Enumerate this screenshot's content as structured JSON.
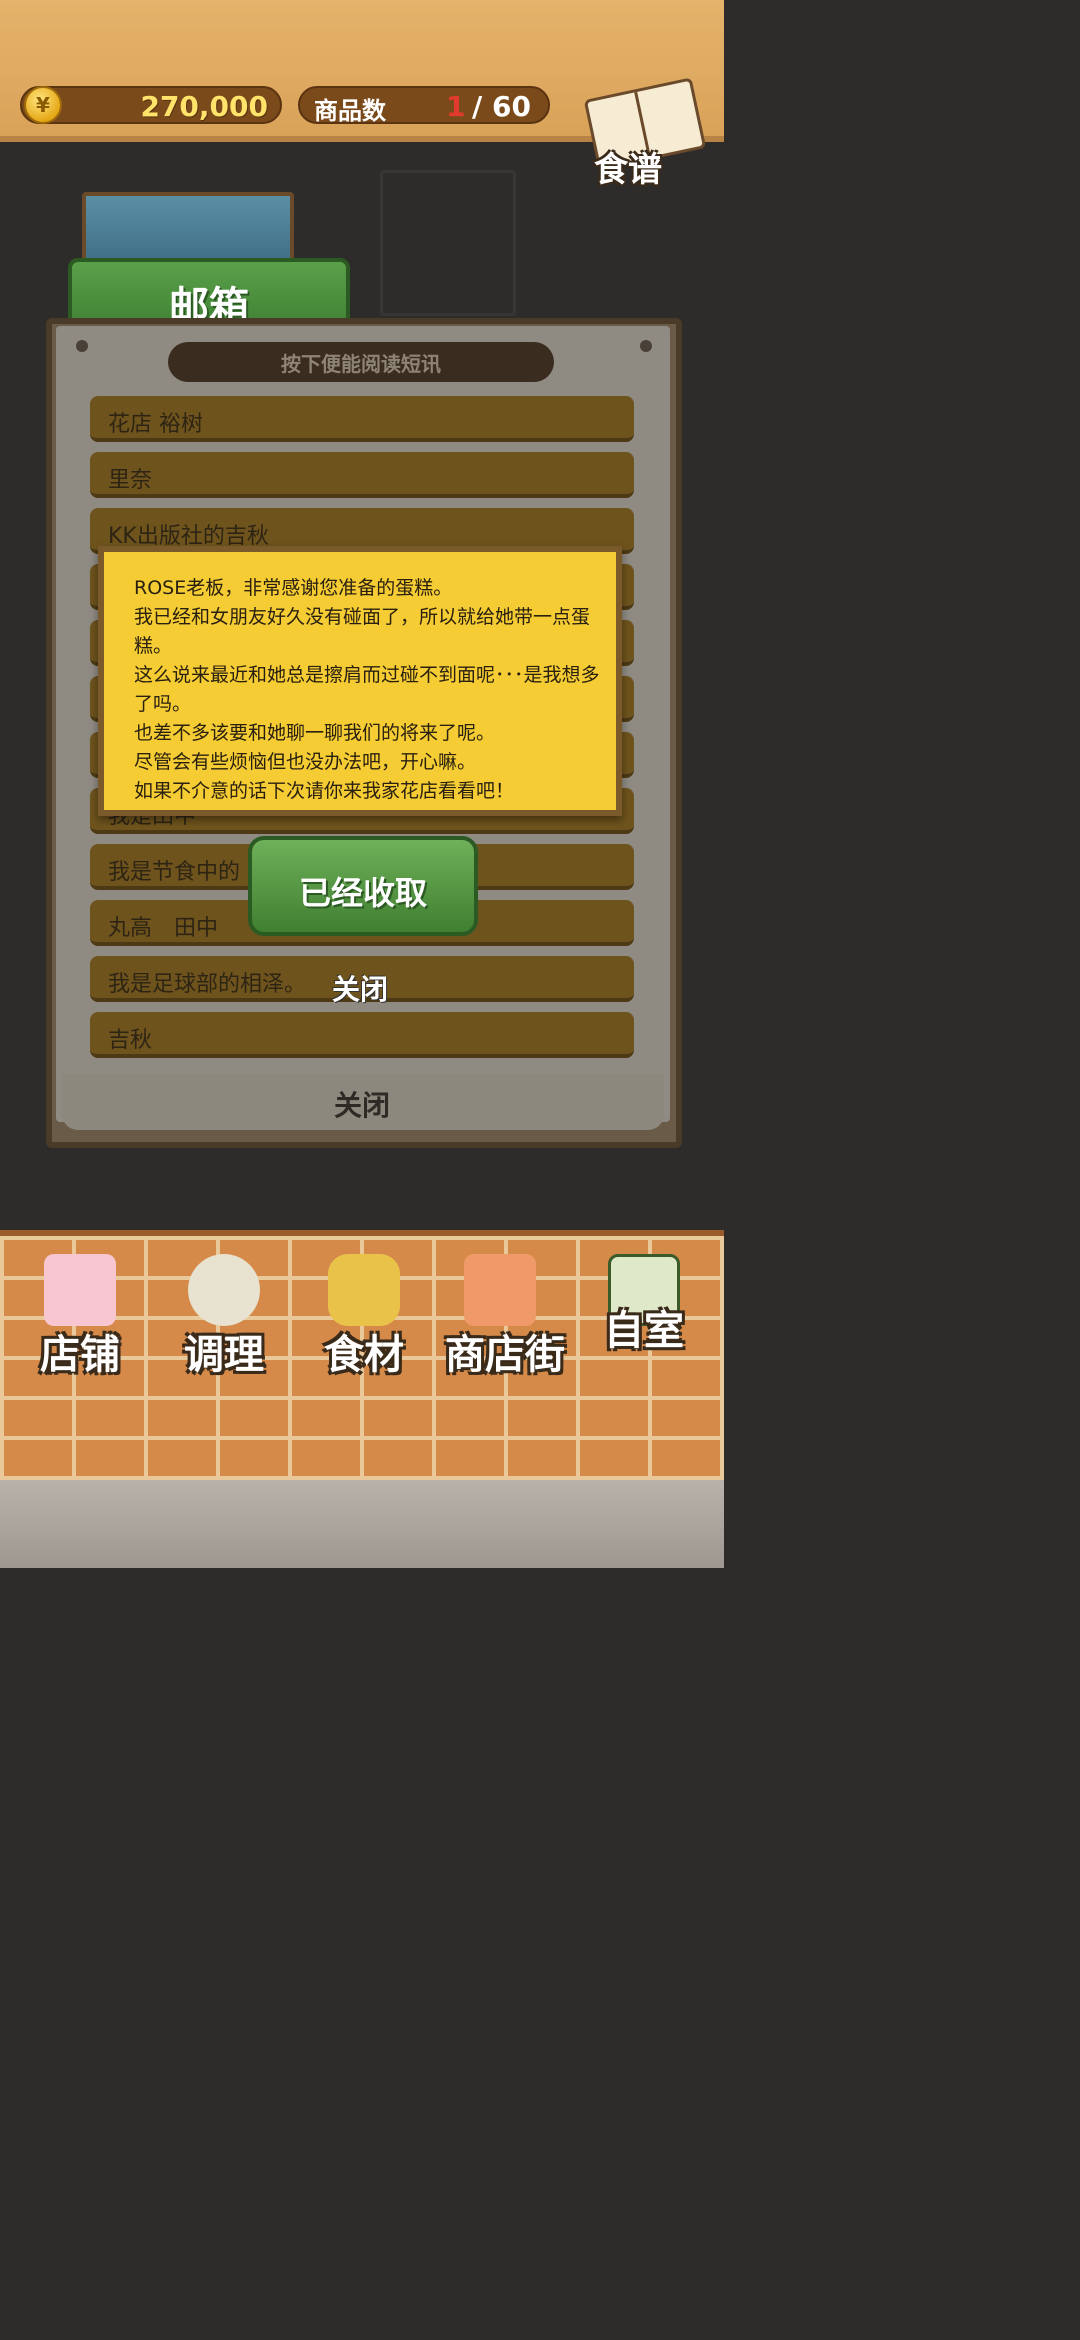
{
  "topbar": {
    "currency_symbol": "¥",
    "money": "270,000",
    "product_count_label": "商品数",
    "product_count_current": "1",
    "product_count_total": "/ 60",
    "recipe_label": "食谱"
  },
  "mailbox": {
    "tab_title": "邮箱",
    "hint": "按下便能阅读短讯",
    "messages": [
      "花店 裕树",
      "里奈",
      "KK出版社的吉秋",
      "",
      "",
      "",
      "",
      "我是田中",
      "我是节食中的",
      "丸高　田中",
      "我是足球部的相泽。",
      "吉秋"
    ],
    "close_label": "关闭"
  },
  "popup": {
    "text": "ROSE老板，非常感谢您准备的蛋糕。\n我已经和女朋友好久没有碰面了，所以就给她带一点蛋糕。\n这么说来最近和她总是擦肩而过碰不到面呢･･･是我想多了吗。\n也差不多该要和她聊一聊我们的将来了呢。\n尽管会有些烦恼但也没办法吧，开心嘛。\n如果不介意的话下次请你来我家花店看看吧！",
    "collected_label": "已经收取",
    "close_label": "关闭"
  },
  "bottom_nav": [
    {
      "label": "店铺",
      "icon": "cake-icon"
    },
    {
      "label": "调理",
      "icon": "mixing-bowl-icon"
    },
    {
      "label": "食材",
      "icon": "flour-sack-icon"
    },
    {
      "label": "商店街",
      "icon": "shop-street-icon"
    },
    {
      "label": "自室",
      "icon": "staff-only-icon"
    }
  ],
  "colors": {
    "accent_green": "#4a8f3c",
    "note_yellow": "#f5cc33",
    "count_red": "#e23b2e"
  }
}
